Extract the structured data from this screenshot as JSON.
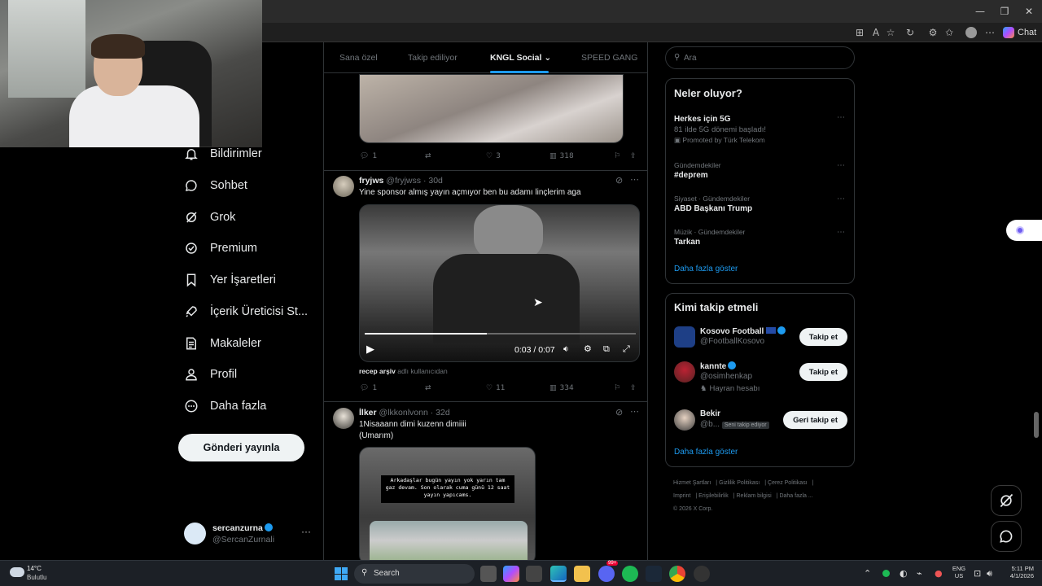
{
  "nav": {
    "items": [
      {
        "label": "Bildirimler",
        "icon": "bell-icon"
      },
      {
        "label": "Sohbet",
        "icon": "chat-icon"
      },
      {
        "label": "Grok",
        "icon": "grok-icon"
      },
      {
        "label": "Premium",
        "icon": "premium-icon"
      },
      {
        "label": "Yer İşaretleri",
        "icon": "bookmark-icon"
      },
      {
        "label": "İçerik Üreticisi St...",
        "icon": "rocket-icon"
      },
      {
        "label": "Makaleler",
        "icon": "article-icon"
      },
      {
        "label": "Profil",
        "icon": "profile-icon"
      },
      {
        "label": "Daha fazla",
        "icon": "more-circle-icon"
      }
    ],
    "post_button": "Gönderi yayınla",
    "account": {
      "name": "sercanzurna",
      "handle": "@SercanZurnali",
      "menu": "···"
    }
  },
  "tabs": {
    "items": [
      "Sana özel",
      "Takip ediliyor",
      "KNGL Social",
      "SPEED GANG"
    ],
    "active": "KNGL Social"
  },
  "feed": {
    "post0": {
      "replies": "1",
      "retweets": "",
      "likes": "3",
      "views": "318"
    },
    "post1": {
      "name": "fryjws",
      "handle": "@fryjwss",
      "age": "· 30d",
      "text": "Yine sponsor almış yayın açmıyor ben bu adamı linçlerim aga",
      "video_time": "0:03 / 0:07",
      "video_progress": 0.45,
      "tag_user": "recep arşiv",
      "tag_suffix": "adlı kullanıcıdan",
      "replies": "1",
      "retweets": "",
      "likes": "11",
      "views": "334"
    },
    "post2": {
      "name": "İlker",
      "handle": "@lkkonlvonn",
      "age": "· 32d",
      "text_line1": "1Nisaaann dimi kuzenn dimiiii",
      "text_line2": "(Umarım)",
      "image_caption": "Arkadaşlar bugün yayın yok yarın tam gaz devam. Son olarak cuma günü 12 saat yayın yapıcams."
    }
  },
  "search": {
    "placeholder": "Ara"
  },
  "trends": {
    "title": "Neler oluyor?",
    "items": [
      {
        "meta": "",
        "title": "Herkes için 5G",
        "sub": "81 ilde 5G dönemi başladı!",
        "promo": "Promoted by Türk Telekom"
      },
      {
        "meta": "Gündemdekiler",
        "title": "#deprem",
        "sub": "",
        "promo": ""
      },
      {
        "meta": "Siyaset · Gündemdekiler",
        "title": "ABD Başkanı Trump",
        "sub": "",
        "promo": ""
      },
      {
        "meta": "Müzik · Gündemdekiler",
        "title": "Tarkan",
        "sub": "",
        "promo": ""
      }
    ],
    "show_more": "Daha fazla göster"
  },
  "who_to_follow": {
    "title": "Kimi takip etmeli",
    "items": [
      {
        "name": "Kosovo Football",
        "handle": "@FootballKosovo",
        "extra": "",
        "button": "Takip et"
      },
      {
        "name": "kannte",
        "handle": "@osimhenkap",
        "extra": "Hayran hesabı",
        "button": "Takip et"
      },
      {
        "name": "Bekir",
        "handle": "@b...",
        "extra": "Seni takip ediyor",
        "button": "Geri takip et"
      }
    ],
    "show_more": "Daha fazla göster"
  },
  "footer": {
    "links": [
      "Hizmet Şartları",
      "Gizlilik Politikası",
      "Çerez Politikası",
      "Imprint",
      "Erişilebilirlik",
      "Reklam bilgisi",
      "Daha fazla ..."
    ],
    "copyright": "© 2026 X Corp."
  },
  "browser": {
    "chat_label": "Chat"
  },
  "taskbar": {
    "weather_temp": "14°C",
    "weather_desc": "Bulutlu",
    "search_label": "Search",
    "lang1": "ENG",
    "lang2": "US",
    "time": "5:11 PM",
    "date": "4/1/2026",
    "badge_count": "99+"
  },
  "colors": {
    "accent": "#1d9bf0",
    "background": "#000000",
    "border": "#2f3336"
  }
}
